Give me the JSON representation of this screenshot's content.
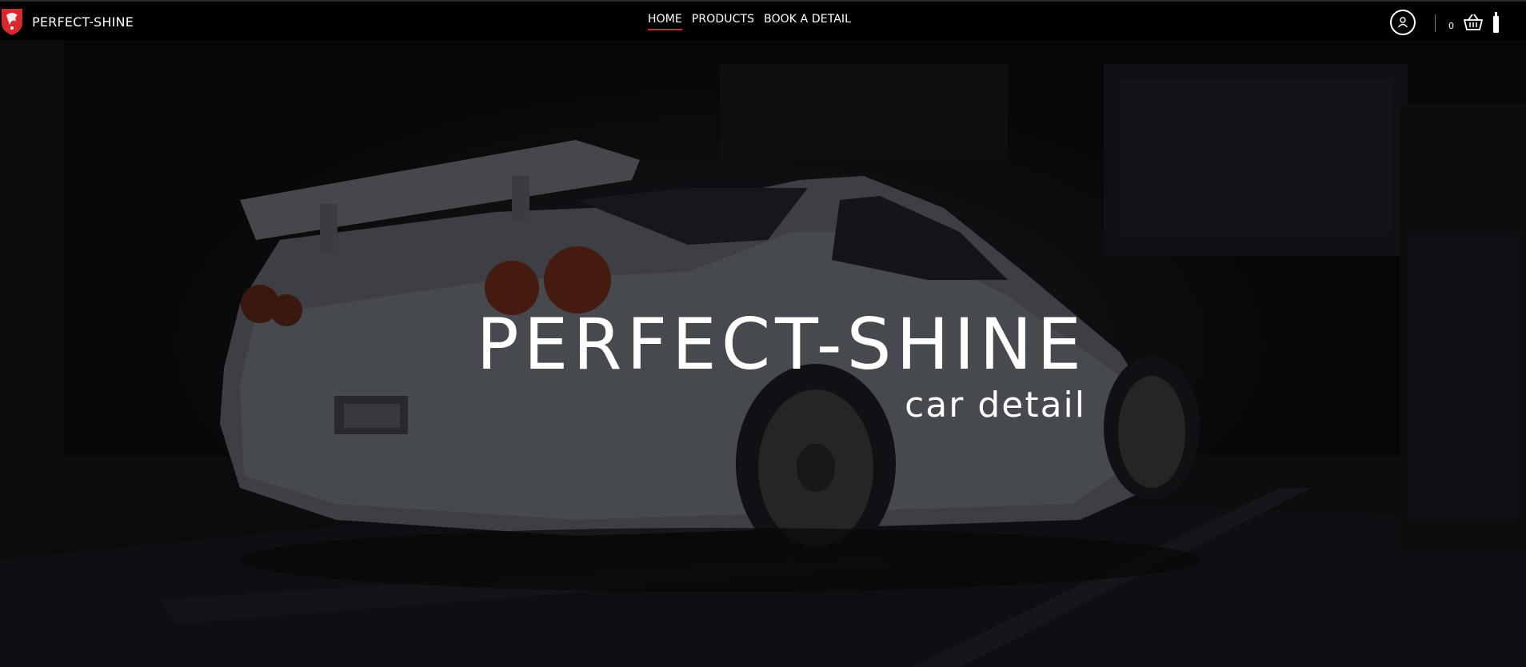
{
  "brand": {
    "name": "PERFECT-SHINE",
    "logo_icon": "dragon-shield-icon",
    "accent": "#e3262a"
  },
  "nav": {
    "items": [
      {
        "label": "HOME",
        "active": true
      },
      {
        "label": "PRODUCTS",
        "active": false
      },
      {
        "label": "BOOK A DETAIL",
        "active": false
      }
    ]
  },
  "header_icons": {
    "account_icon": "user-icon",
    "cart_count": "0",
    "cart_icon": "basket-icon",
    "extra_icon": "bottle-icon"
  },
  "hero": {
    "title": "PERFECT-SHINE",
    "subtitle": "car detail",
    "background": "dark garage photo of a white sports car"
  }
}
